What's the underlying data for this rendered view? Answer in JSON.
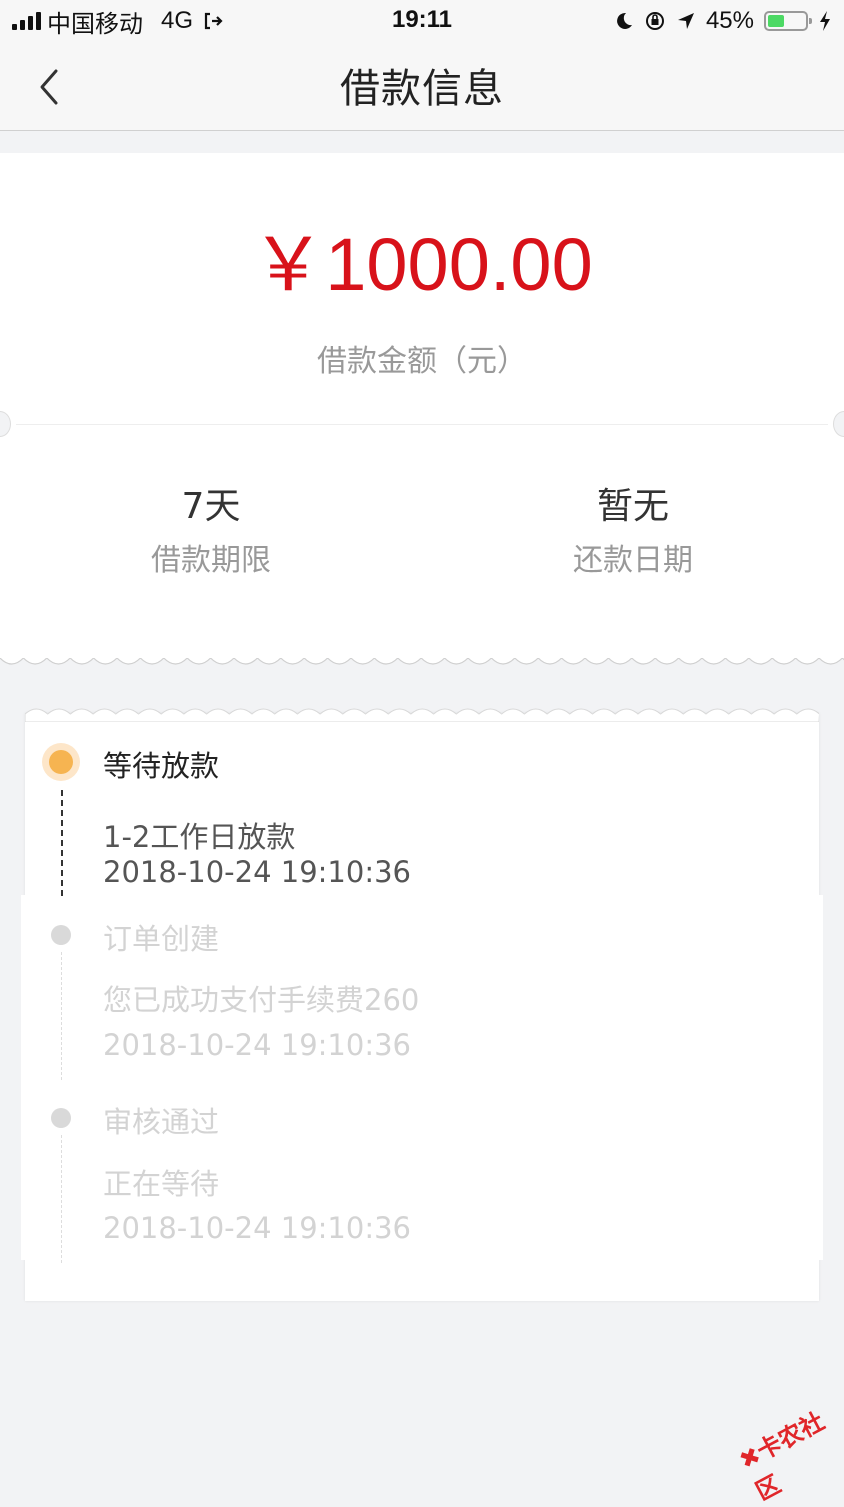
{
  "status_bar": {
    "carrier": "中国移动",
    "network": "4G",
    "time": "19:11",
    "battery_percent": "45%",
    "battery_level": 0.45,
    "icons": [
      "signal-icon",
      "hotspot-icon",
      "moon-icon",
      "orientation-lock-icon",
      "location-icon",
      "battery-icon",
      "charging-icon"
    ]
  },
  "nav": {
    "title": "借款信息",
    "back_icon": "chevron-left-icon"
  },
  "loan": {
    "amount": "￥1000.00",
    "amount_label": "借款金额（元）",
    "term_value": "7天",
    "term_label": "借款期限",
    "repay_value": "暂无",
    "repay_label": "还款日期"
  },
  "timeline": [
    {
      "title": "等待放款",
      "detail": "1-2工作日放款",
      "time": "2018-10-24 19:10:36",
      "status": "active",
      "color": "#f6b451"
    },
    {
      "title": "订单创建",
      "detail": "您已成功支付手续费260",
      "time": "2018-10-24 19:10:36",
      "status": "done"
    },
    {
      "title": "审核通过",
      "detail": "正在等待",
      "time": "2018-10-24 19:10:36",
      "status": "done"
    }
  ],
  "colors": {
    "amount": "#d8121a",
    "active_dot": "#f6b451",
    "background": "#f2f3f5"
  },
  "watermark": "卡农社区"
}
